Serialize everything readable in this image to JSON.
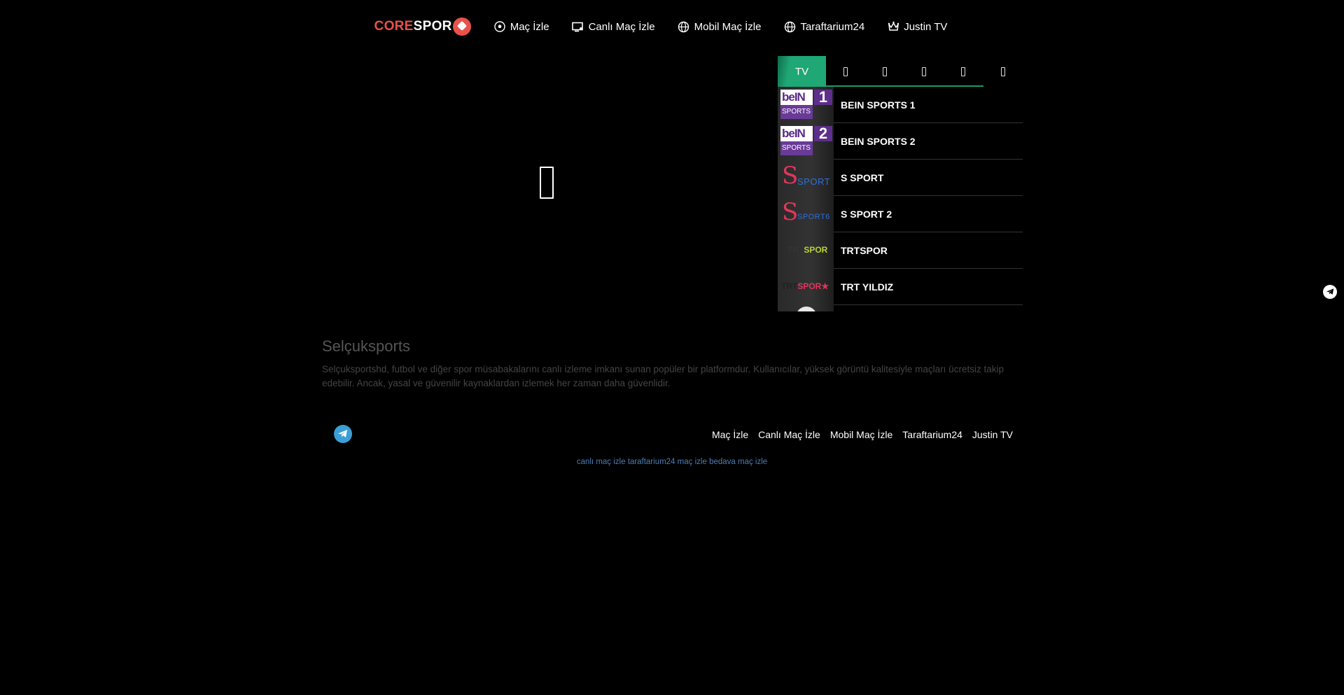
{
  "header": {
    "logo_core": "CORE",
    "logo_spor": "SPOR",
    "nav": [
      {
        "label": "Maç İzle",
        "icon": "soccer-ball-icon"
      },
      {
        "label": "Canlı Maç İzle",
        "icon": "live-screen-icon"
      },
      {
        "label": "Mobil Maç İzle",
        "icon": "globe-icon"
      },
      {
        "label": "Taraftarium24",
        "icon": "globe-icon"
      },
      {
        "label": "Justin TV",
        "icon": "crown-icon"
      }
    ]
  },
  "panel": {
    "active_tab": "TV",
    "channels": [
      {
        "name": "BEIN SPORTS 1",
        "logo": "bein-1",
        "num": "1",
        "logo_top": "beIN",
        "logo_bottom": "SPORTS"
      },
      {
        "name": "BEIN SPORTS 2",
        "logo": "bein-2",
        "num": "2",
        "logo_top": "beIN",
        "logo_bottom": "SPORTS"
      },
      {
        "name": "S SPORT",
        "logo": "s-sport",
        "logo_s": "S",
        "logo_text": "SPORT"
      },
      {
        "name": "S SPORT 2",
        "logo": "s-sport-2",
        "logo_s": "S",
        "logo_text": "SPORT6"
      },
      {
        "name": "TRTSPOR",
        "logo": "trt-spor",
        "logo_a": "TRT",
        "logo_b": "SPOR"
      },
      {
        "name": "TRT YILDIZ",
        "logo": "trt-yildiz",
        "logo_a": "TRT",
        "logo_b": "SPOR★"
      }
    ]
  },
  "about": {
    "title": "Selçuksports",
    "text": "Selçuksportshd, futbol ve diğer spor müsabakalarını canlı izleme imkanı sunan popüler bir platformdur. Kullanıcılar, yüksek görüntü kalitesiyle maçları ücretsiz takip edebilir. Ancak, yasal ve güvenilir kaynaklardan izlemek her zaman daha güvenlidir."
  },
  "footer": {
    "nav": [
      "Maç İzle",
      "Canlı Maç İzle",
      "Mobil Maç İzle",
      "Taraftarium24",
      "Justin TV"
    ],
    "links": [
      "canlı maç izle",
      "taraftarium24",
      "maç izle",
      "bedava maç izle"
    ]
  },
  "colors": {
    "accent": "#1fa776",
    "logo_red": "#e8524a",
    "link_blue": "#4a7db5",
    "telegram": "#3b9ed6"
  }
}
